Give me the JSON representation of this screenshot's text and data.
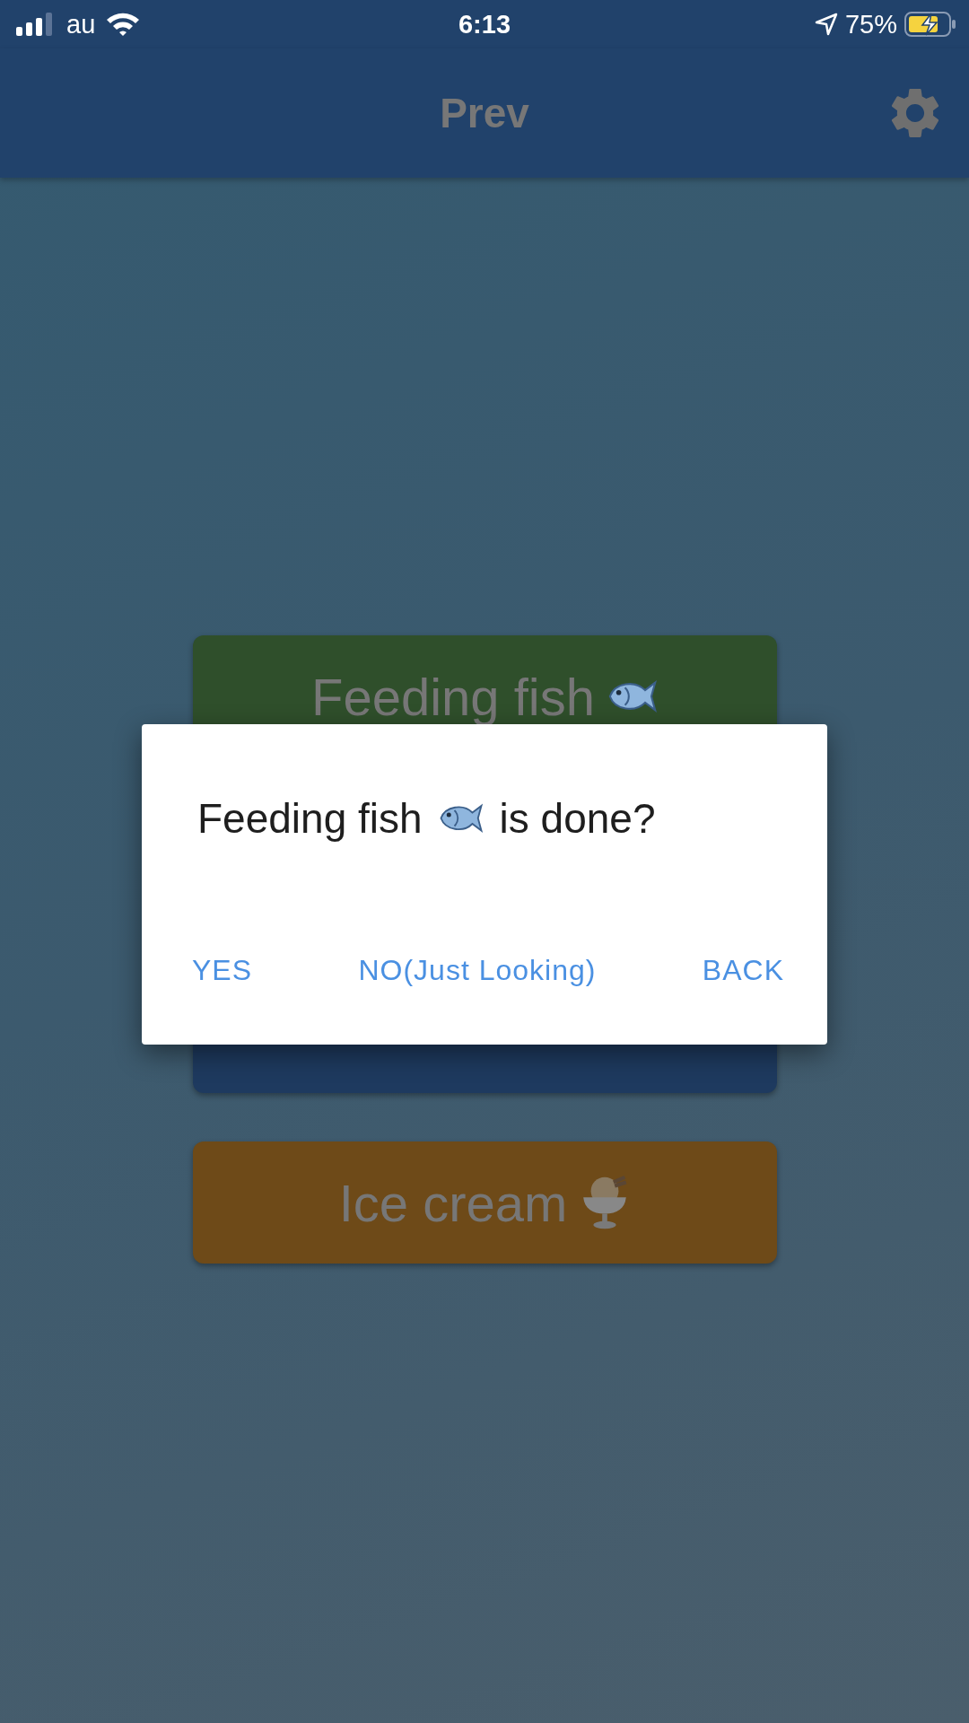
{
  "status_bar": {
    "carrier": "au",
    "time": "6:13",
    "battery": "75%",
    "charging": true
  },
  "app_bar": {
    "title": "Prev"
  },
  "tasks": [
    {
      "label": "Feeding fish",
      "kind": "fish",
      "color": "#2f4f2b"
    },
    {
      "kind": "plain",
      "color": "#1e3a5f"
    },
    {
      "label": "Ice cream",
      "kind": "ice-cream",
      "color": "#6e4a18"
    }
  ],
  "dialog": {
    "subject": "Feeding fish",
    "kind": "fish",
    "suffix": "is done?",
    "actions": [
      "YES",
      "NO(Just Looking)",
      "BACK"
    ]
  }
}
